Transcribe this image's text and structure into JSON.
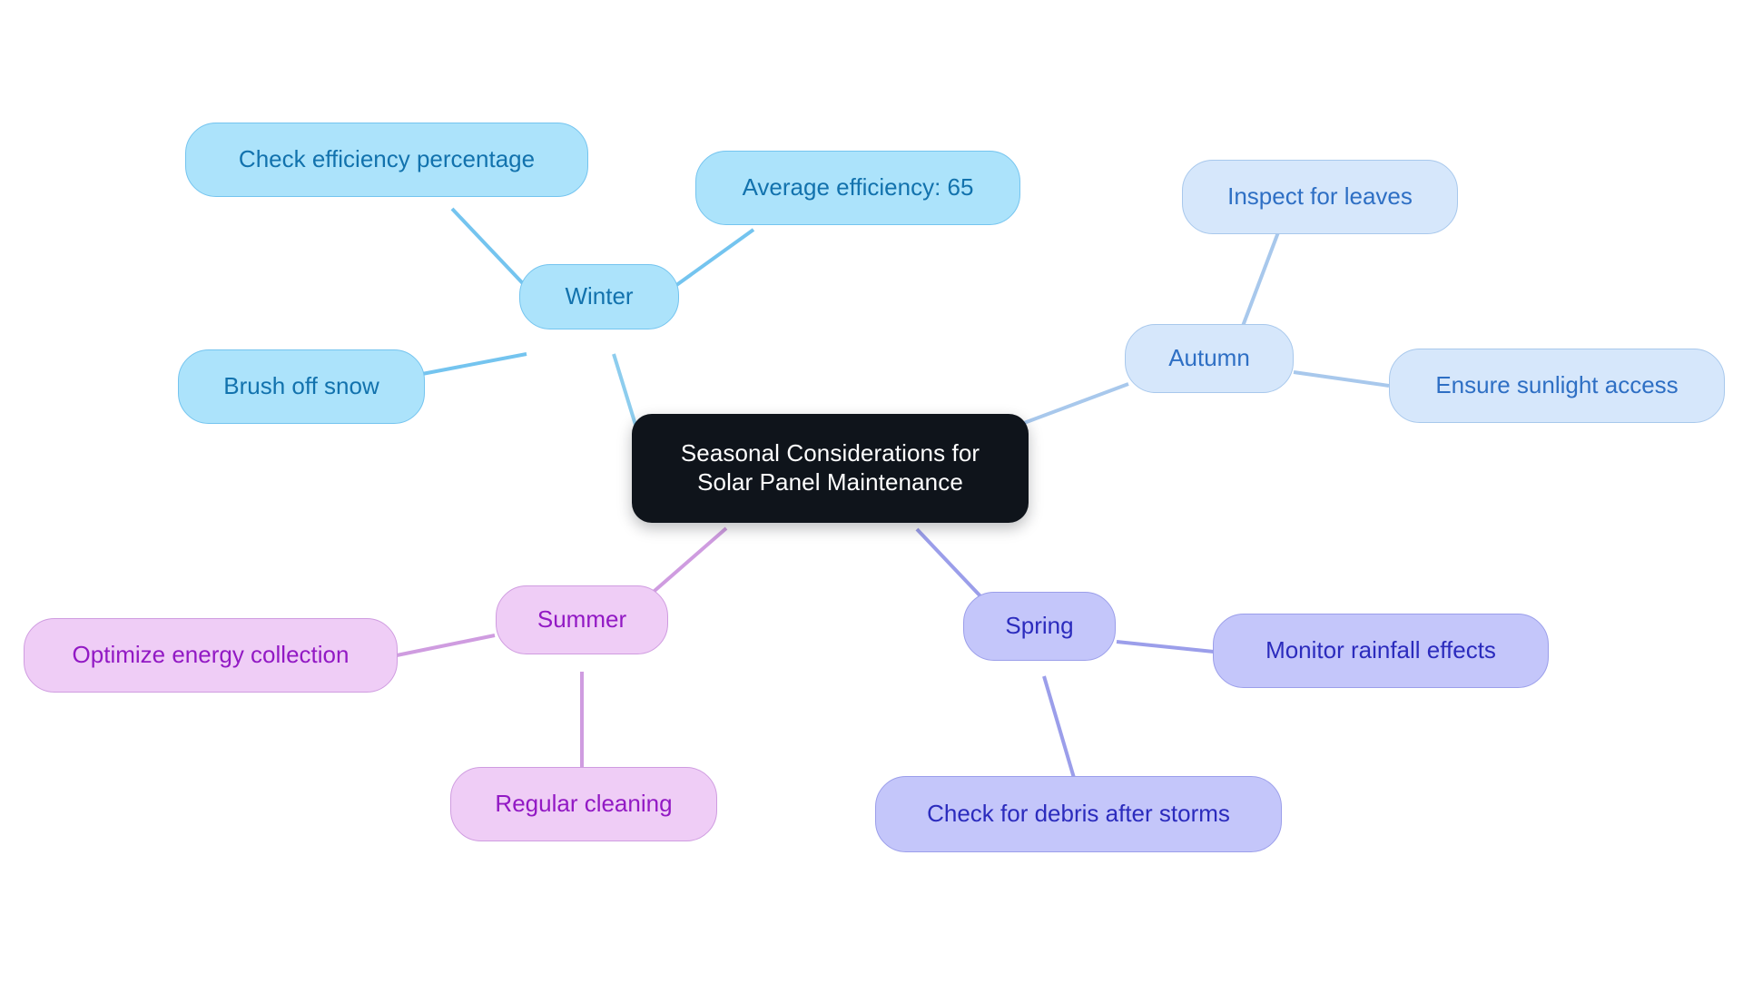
{
  "diagram": {
    "type": "mindmap",
    "background_color": "#ffffff",
    "root": {
      "label": "Seasonal Considerations for Solar Panel Maintenance",
      "line1": "Seasonal Considerations for",
      "line2": "Solar Panel Maintenance",
      "fill_color": "#0f141b",
      "text_color": "#ffffff"
    },
    "branches": [
      {
        "id": "winter",
        "label": "Winter",
        "fill_color": "#ace3fb",
        "border_color": "#74c4ef",
        "text_color": "#1272ad",
        "edge_color": "#74c4ef",
        "children": [
          {
            "id": "winter-check-efficiency",
            "label": "Check efficiency percentage"
          },
          {
            "id": "winter-average-efficiency",
            "label": "Average efficiency: 65"
          },
          {
            "id": "winter-brush-snow",
            "label": "Brush off snow"
          }
        ]
      },
      {
        "id": "autumn",
        "label": "Autumn",
        "fill_color": "#d6e7fb",
        "border_color": "#a8c8ec",
        "text_color": "#2e6fc4",
        "edge_color": "#a8c8ec",
        "children": [
          {
            "id": "autumn-inspect-leaves",
            "label": "Inspect for leaves"
          },
          {
            "id": "autumn-sunlight-access",
            "label": "Ensure sunlight access"
          }
        ]
      },
      {
        "id": "summer",
        "label": "Summer",
        "fill_color": "#efcdf6",
        "border_color": "#cf9ce0",
        "text_color": "#9219c4",
        "edge_color": "#cf9ce0",
        "children": [
          {
            "id": "summer-optimize-energy",
            "label": "Optimize energy collection"
          },
          {
            "id": "summer-regular-cleaning",
            "label": "Regular cleaning"
          }
        ]
      },
      {
        "id": "spring",
        "label": "Spring",
        "fill_color": "#c4c6fa",
        "border_color": "#9b9eea",
        "text_color": "#2b2bbd",
        "edge_color": "#9b9eea",
        "children": [
          {
            "id": "spring-monitor-rainfall",
            "label": "Monitor rainfall effects"
          },
          {
            "id": "spring-check-debris",
            "label": "Check for debris after storms"
          }
        ]
      }
    ]
  }
}
